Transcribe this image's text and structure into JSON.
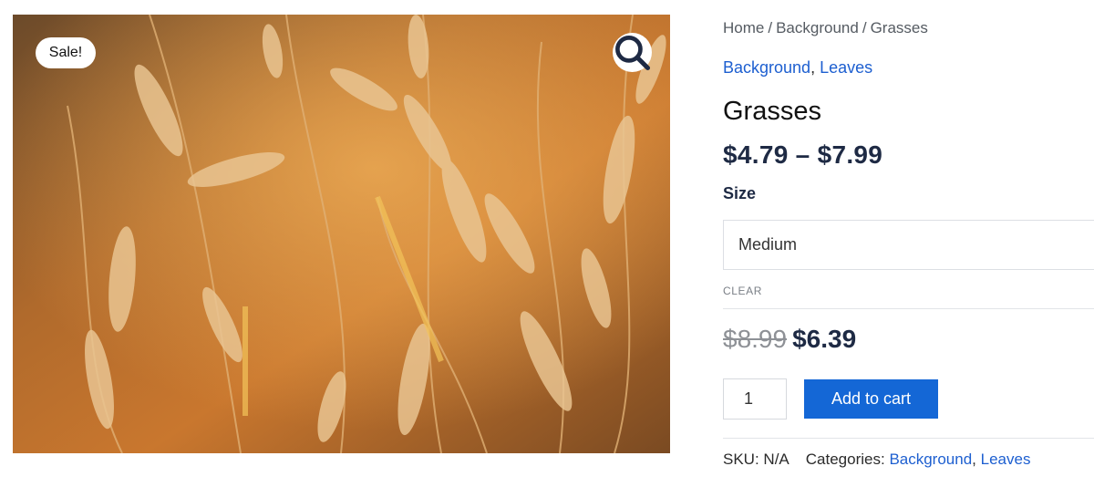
{
  "gallery": {
    "sale_badge": "Sale!",
    "zoom_icon": "search-icon",
    "image_subject": "grass-field-photo"
  },
  "breadcrumb": {
    "items": [
      "Home",
      "Background",
      "Grasses"
    ],
    "separator": "/"
  },
  "categories_top": {
    "items": [
      "Background",
      "Leaves"
    ],
    "separator": ","
  },
  "product": {
    "title": "Grasses",
    "price_range": "$4.79 – $7.99",
    "variation": {
      "label": "Size",
      "selected": "Medium",
      "clear_label": "CLEAR"
    },
    "sale": {
      "old_price": "$8.99",
      "new_price": "$6.39"
    },
    "quantity": "1",
    "add_to_cart_label": "Add to cart"
  },
  "meta": {
    "sku_label": "SKU:",
    "sku_value": "N/A",
    "categories_label": "Categories:",
    "categories": [
      "Background",
      "Leaves"
    ],
    "separator": ","
  },
  "colors": {
    "accent": "#1467d6",
    "link": "#1d5fd0",
    "price": "#1e2a44"
  }
}
